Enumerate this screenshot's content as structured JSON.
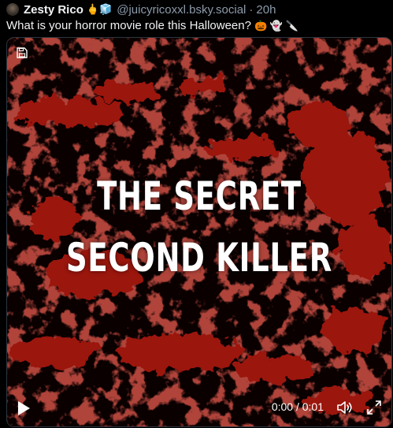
{
  "post": {
    "display_name": "Zesty Rico",
    "name_emoji": "🖕🧊",
    "handle": "@juicyricoxxl.bsky.social",
    "separator": "·",
    "time": "20h",
    "text": "What is your horror movie role this Halloween?",
    "text_emoji": "🎃 👻 🔪"
  },
  "video": {
    "title_line_1": "THE SECRET",
    "title_line_2": "SECOND KILLER",
    "time_readout": "0:00 / 0:01",
    "icons": {
      "save": "save-icon",
      "play": "play-icon",
      "volume": "volume-icon",
      "fullscreen": "fullscreen-icon"
    },
    "colors": {
      "splatter": "#9b140f",
      "background": "#0a0000"
    }
  }
}
